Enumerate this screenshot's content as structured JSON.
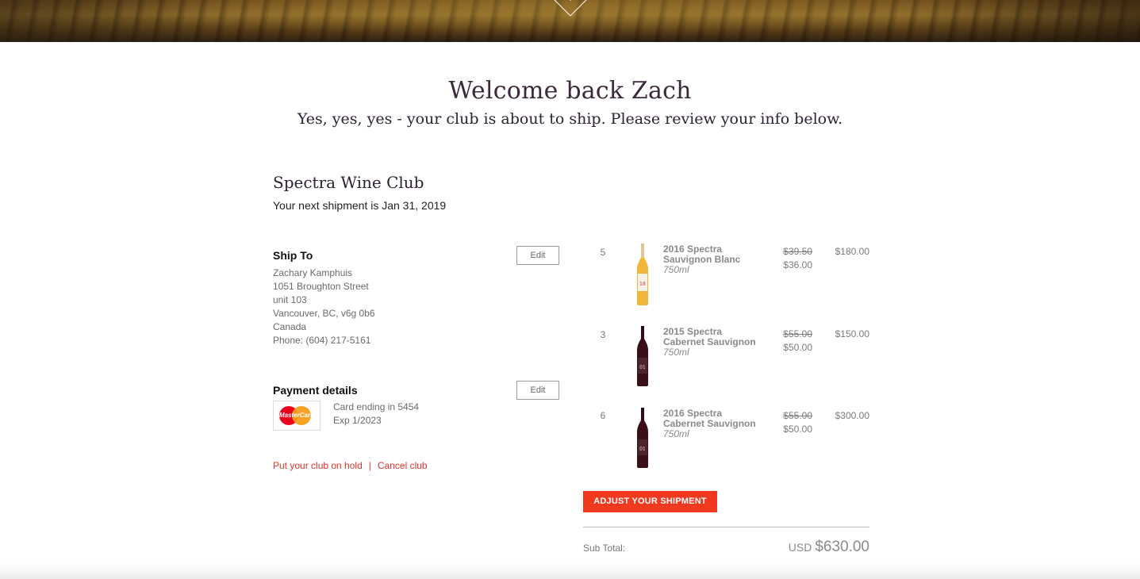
{
  "hero": {
    "icon": "download-arrow-icon",
    "glyph": "↓"
  },
  "welcome": {
    "title": "Welcome back Zach",
    "subtitle": "Yes, yes, yes - your club is about to ship. Please review your info below."
  },
  "club": {
    "name": "Spectra Wine Club",
    "next_shipment": "Your next shipment is Jan 31, 2019"
  },
  "ship_to": {
    "title": "Ship To",
    "edit_label": "Edit",
    "lines": [
      "Zachary Kamphuis",
      "1051 Broughton Street",
      "unit 103",
      "Vancouver, BC, v6g 0b6",
      "Canada",
      "Phone: (604) 217-5161"
    ]
  },
  "payment": {
    "title": "Payment details",
    "edit_label": "Edit",
    "card_brand": "MasterCard",
    "card_ending": "Card ending in 5454",
    "expiry": "Exp 1/2023"
  },
  "links": {
    "hold": "Put your club on hold",
    "separator": "|",
    "cancel": "Cancel club"
  },
  "products": [
    {
      "qty": "5",
      "name": "2016 Spectra Sauvignon Blanc",
      "size": "750ml",
      "old_price": "$39.50",
      "new_price": "$36.00",
      "total": "$180.00",
      "bottle": "white",
      "label": "18"
    },
    {
      "qty": "3",
      "name": "2015 Spectra Cabernet Sauvignon",
      "size": "750ml",
      "old_price": "$55.00",
      "new_price": "$50.00",
      "total": "$150.00",
      "bottle": "red",
      "label": "01"
    },
    {
      "qty": "6",
      "name": "2016 Spectra Cabernet Sauvignon",
      "size": "750ml",
      "old_price": "$55.00",
      "new_price": "$50.00",
      "total": "$300.00",
      "bottle": "red",
      "label": "01"
    }
  ],
  "adjust_label": "ADJUST YOUR SHIPMENT",
  "subtotal": {
    "label": "Sub Total:",
    "currency": "USD",
    "amount": "$630.00"
  },
  "colors": {
    "accent": "#f0391f",
    "link": "#e0342a",
    "heading": "#2d2233"
  }
}
